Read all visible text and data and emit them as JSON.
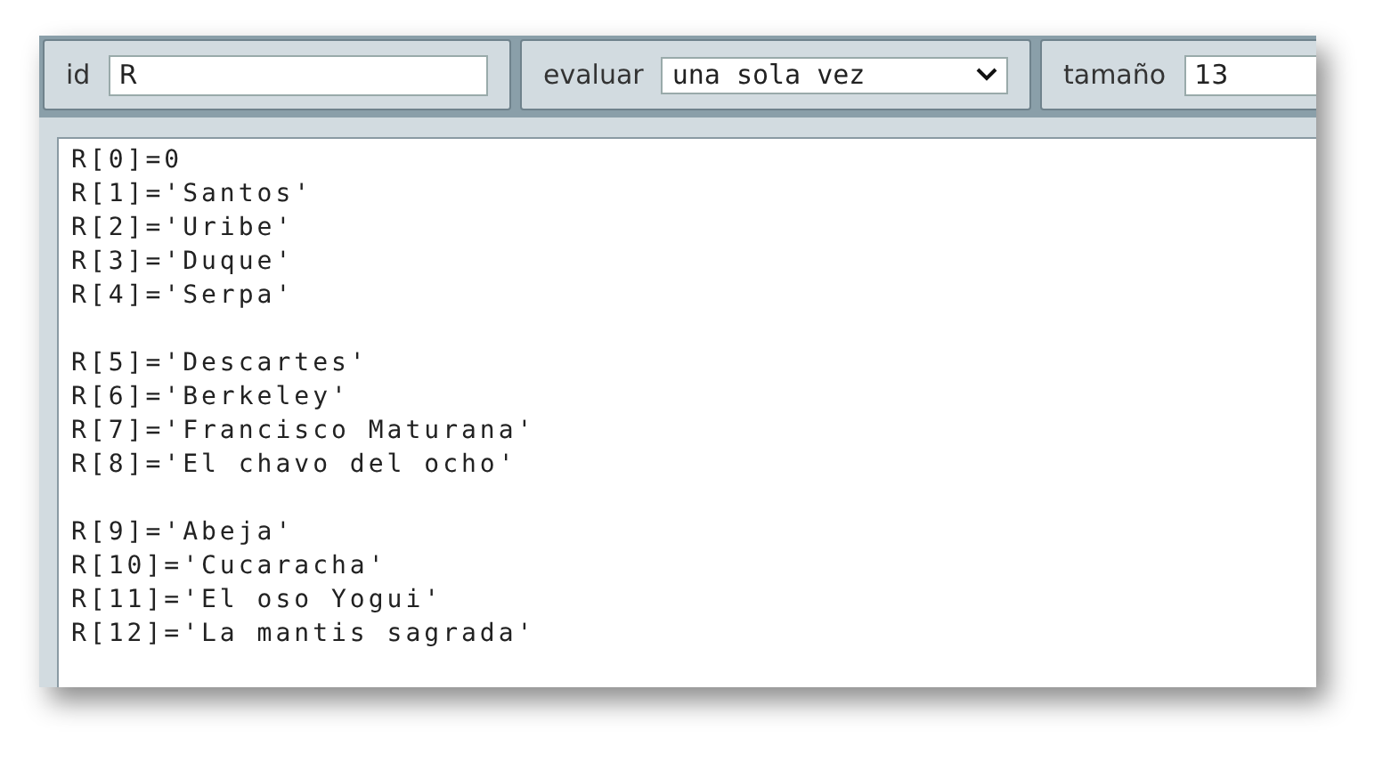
{
  "toolbar": {
    "id": {
      "label": "id",
      "value": "R"
    },
    "evaluate": {
      "label": "evaluar",
      "value": "una sola vez"
    },
    "size": {
      "label": "tamaño",
      "value": "13"
    }
  },
  "editor": {
    "groups": [
      [
        "R[0]=0",
        "R[1]='Santos'",
        "R[2]='Uribe'",
        "R[3]='Duque'",
        "R[4]='Serpa'"
      ],
      [
        "R[5]='Descartes'",
        "R[6]='Berkeley'",
        "R[7]='Francisco Maturana'",
        "R[8]='El chavo del ocho'"
      ],
      [
        "R[9]='Abeja'",
        "R[10]='Cucaracha'",
        "R[11]='El oso Yogui'",
        "R[12]='La mantis sagrada'"
      ]
    ]
  }
}
